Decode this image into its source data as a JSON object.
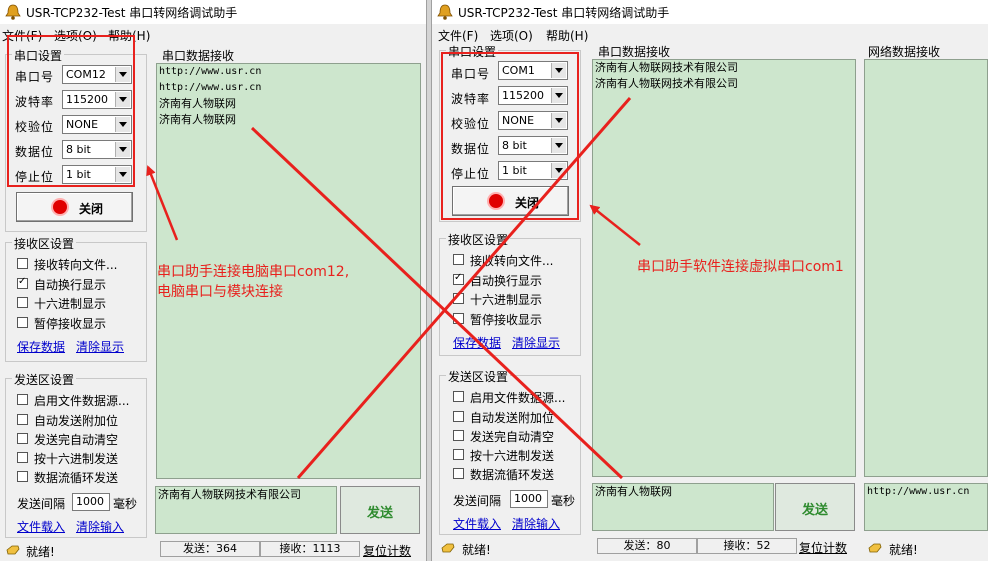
{
  "left": {
    "title": "USR-TCP232-Test 串口转网络调试助手",
    "menu": [
      "文件(F)",
      "选项(O)",
      "帮助(H)"
    ],
    "serial_settings_title": "串口设置",
    "serial_fields": [
      {
        "label": "串口号",
        "value": "COM12"
      },
      {
        "label": "波特率",
        "value": "115200"
      },
      {
        "label": "校验位",
        "value": "NONE"
      },
      {
        "label": "数据位",
        "value": "8 bit"
      },
      {
        "label": "停止位",
        "value": "1 bit"
      }
    ],
    "close_button": "关闭",
    "recv_settings_title": "接收区设置",
    "recv_options": [
      {
        "label": "接收转向文件...",
        "checked": false
      },
      {
        "label": "自动换行显示",
        "checked": true
      },
      {
        "label": "十六进制显示",
        "checked": false
      },
      {
        "label": "暂停接收显示",
        "checked": false
      }
    ],
    "save_data": "保存数据",
    "clear_display": "清除显示",
    "send_settings_title": "发送区设置",
    "send_options": [
      {
        "label": "启用文件数据源...",
        "checked": false
      },
      {
        "label": "自动发送附加位",
        "checked": false
      },
      {
        "label": "发送完自动清空",
        "checked": false
      },
      {
        "label": "按十六进制发送",
        "checked": false
      },
      {
        "label": "数据流循环发送",
        "checked": false
      }
    ],
    "send_interval_label": "发送间隔",
    "send_interval_value": "1000",
    "send_interval_unit": "毫秒",
    "file_load": "文件载入",
    "clear_input": "清除输入",
    "recv_area_title": "串口数据接收",
    "recv_lines": [
      "http://www.usr.cn",
      "http://www.usr.cn",
      "济南有人物联网",
      "济南有人物联网"
    ],
    "send_text": "济南有人物联网技术有限公司",
    "send_button": "发送",
    "status_ready": "就绪!",
    "status_sent": "发送：364",
    "status_recv": "接收：1113",
    "reset_count": "复位计数"
  },
  "right": {
    "title": "USR-TCP232-Test 串口转网络调试助手",
    "menu": [
      "文件(F)",
      "选项(O)",
      "帮助(H)"
    ],
    "serial_settings_title": "串口设置",
    "serial_fields": [
      {
        "label": "串口号",
        "value": "COM1"
      },
      {
        "label": "波特率",
        "value": "115200"
      },
      {
        "label": "校验位",
        "value": "NONE"
      },
      {
        "label": "数据位",
        "value": "8 bit"
      },
      {
        "label": "停止位",
        "value": "1 bit"
      }
    ],
    "close_button": "关闭",
    "recv_settings_title": "接收区设置",
    "recv_options": [
      {
        "label": "接收转向文件...",
        "checked": false
      },
      {
        "label": "自动换行显示",
        "checked": true
      },
      {
        "label": "十六进制显示",
        "checked": false
      },
      {
        "label": "暂停接收显示",
        "checked": false
      }
    ],
    "save_data": "保存数据",
    "clear_display": "清除显示",
    "send_settings_title": "发送区设置",
    "send_options": [
      {
        "label": "启用文件数据源...",
        "checked": false
      },
      {
        "label": "自动发送附加位",
        "checked": false
      },
      {
        "label": "发送完自动清空",
        "checked": false
      },
      {
        "label": "按十六进制发送",
        "checked": false
      },
      {
        "label": "数据流循环发送",
        "checked": false
      }
    ],
    "send_interval_label": "发送间隔",
    "send_interval_value": "1000",
    "send_interval_unit": "毫秒",
    "file_load": "文件载入",
    "clear_input": "清除输入",
    "recv_area_title": "串口数据接收",
    "recv_lines": [
      "济南有人物联网技术有限公司",
      "济南有人物联网技术有限公司"
    ],
    "send_text": "济南有人物联网",
    "send_button": "发送",
    "net_recv_title": "网络数据接收",
    "net_send_text": "http://www.usr.cn",
    "status_ready": "就绪!",
    "status_sent": "发送：80",
    "status_recv": "接收：52",
    "reset_count": "复位计数"
  },
  "annotations": {
    "left_text_line1": "串口助手连接电脑串口com12,",
    "left_text_line2": "电脑串口与模块连接",
    "right_text": "串口助手软件连接虚拟串口com1"
  },
  "colors": {
    "annotation_red": "#e8211d",
    "recv_area_green": "#cde6cd",
    "send_button_text": "#2e8b2e"
  }
}
